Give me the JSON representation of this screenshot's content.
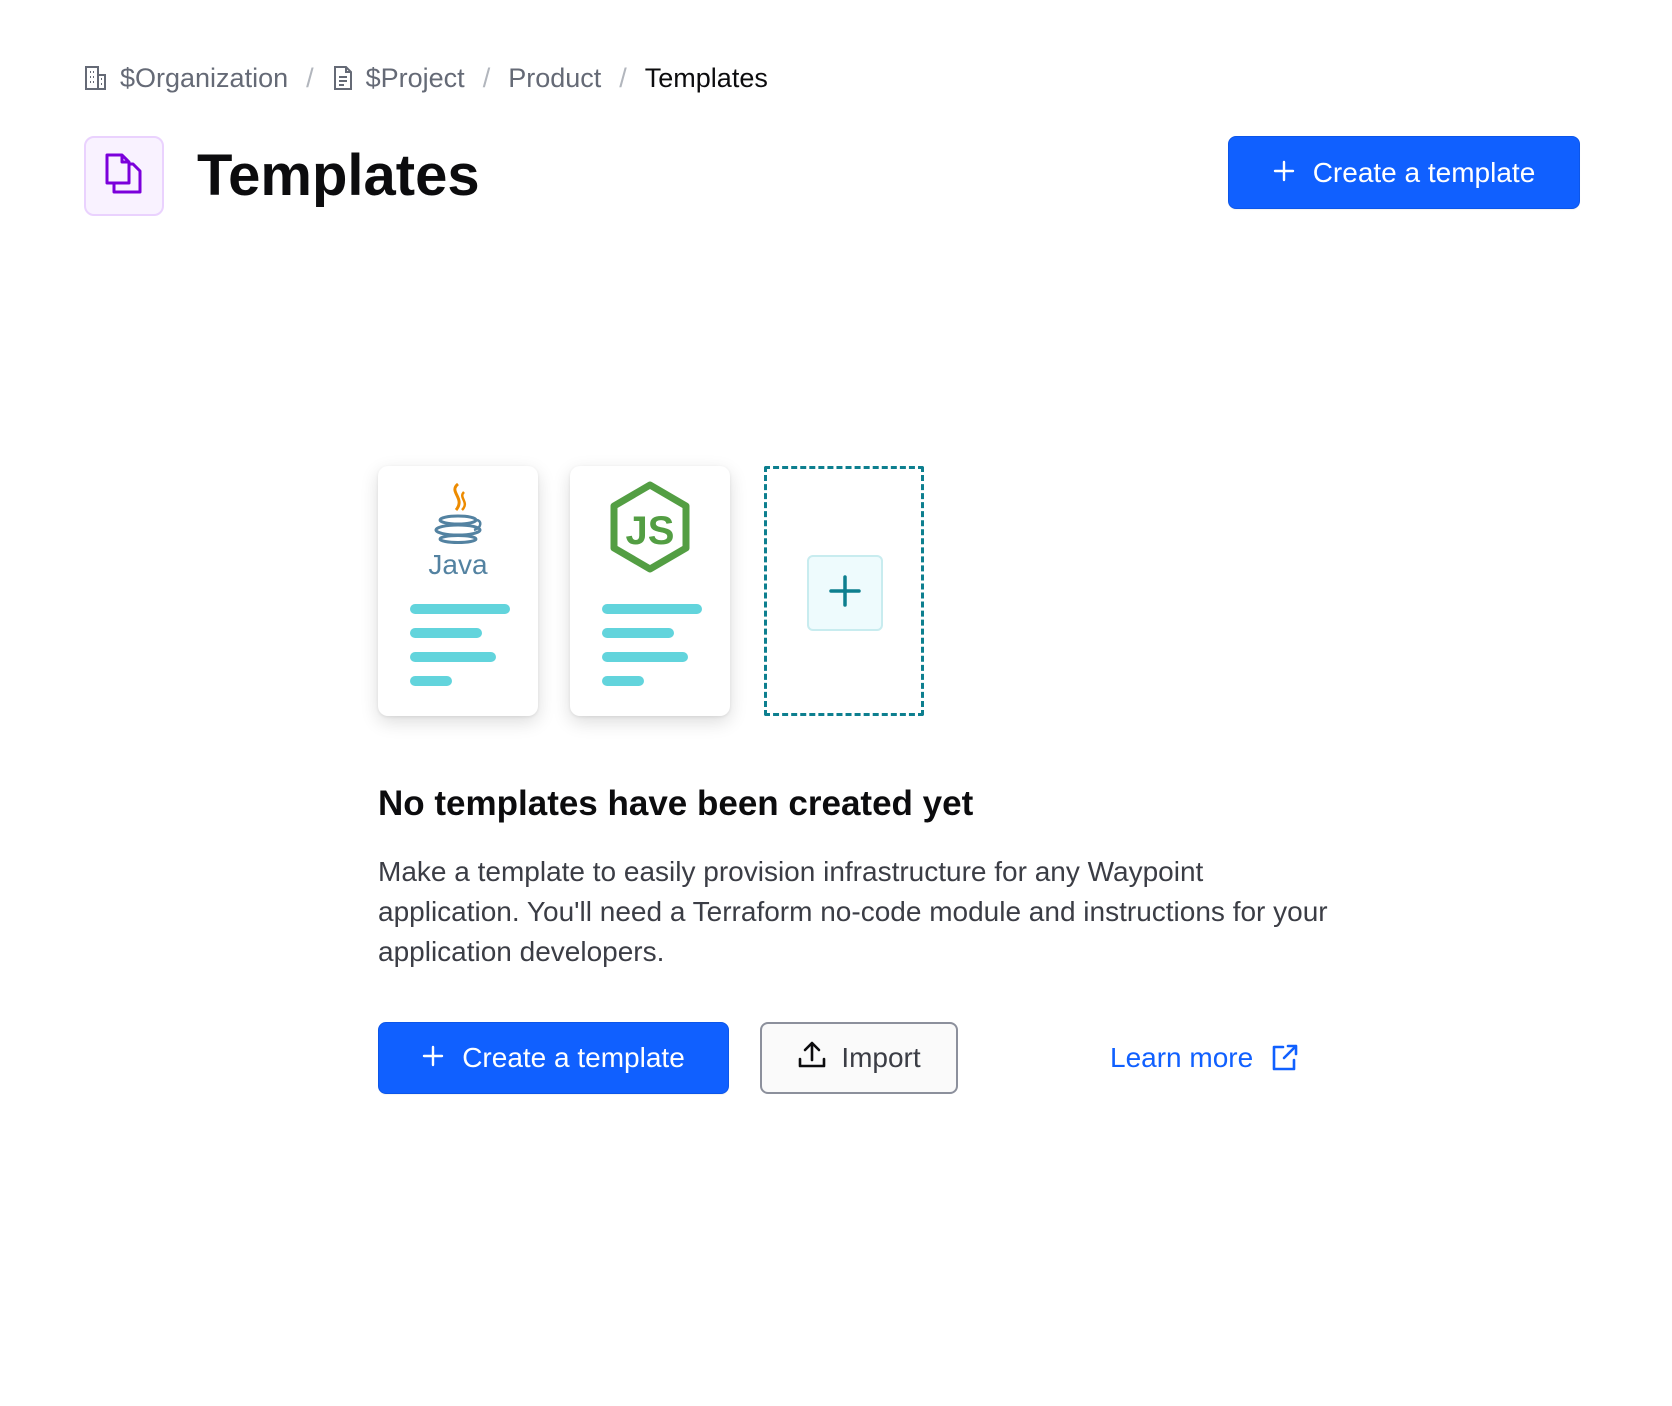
{
  "breadcrumb": {
    "items": [
      {
        "label": "$Organization",
        "icon": "building-icon"
      },
      {
        "label": "$Project",
        "icon": "file-text-icon"
      },
      {
        "label": "Product"
      },
      {
        "label": "Templates"
      }
    ],
    "separator": "/"
  },
  "header": {
    "icon": "files-icon",
    "title": "Templates",
    "create_button_label": "Create a template"
  },
  "illustration": {
    "cards": [
      {
        "name": "java",
        "logo_text": "Java"
      },
      {
        "name": "nodejs",
        "logo_text": "JS"
      },
      {
        "name": "add",
        "icon": "plus-icon"
      }
    ]
  },
  "empty_state": {
    "title": "No templates have been created yet",
    "description": "Make a template to easily provision infrastructure for any Waypoint application. You'll need a Terraform no-code module and instructions for your application developers.",
    "create_button_label": "Create a template",
    "import_button_label": "Import",
    "learn_more_label": "Learn more"
  },
  "colors": {
    "primary": "#1060ff",
    "accent_teal": "#62d4dc",
    "dashed_border": "#0d7f8f",
    "icon_purple": "#7b00db"
  }
}
